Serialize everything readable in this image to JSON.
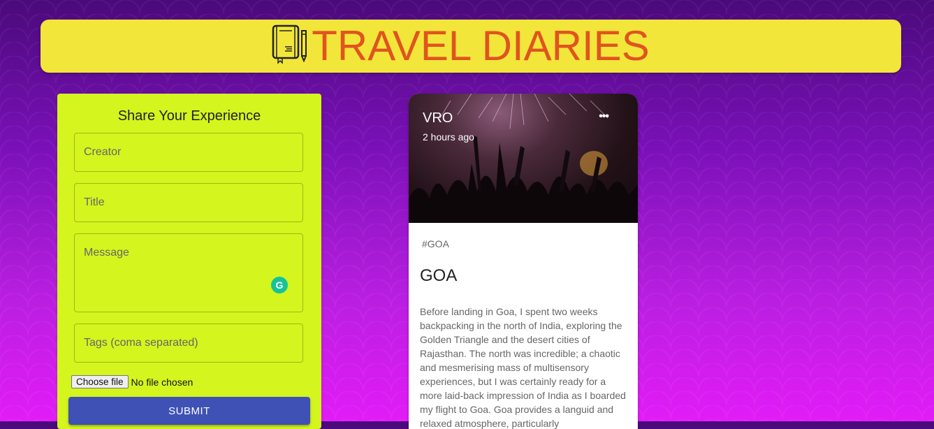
{
  "header": {
    "title": "TRAVEL DIARIES",
    "icon": "diary-book-icon"
  },
  "form": {
    "title": "Share Your Experience",
    "creator_placeholder": "Creator",
    "title_placeholder": "Title",
    "message_placeholder": "Message",
    "tags_placeholder": "Tags (coma separated)",
    "file_button_label": "Choose file",
    "file_status": "No file chosen",
    "submit_label": "SUBMIT",
    "grammarly_glyph": "G"
  },
  "post": {
    "creator": "VRO",
    "time": "2 hours ago",
    "more_glyph": "•••",
    "tags": "#GOA",
    "title": "GOA",
    "message": "Before landing in Goa, I spent two weeks backpacking in the north of India, exploring the Golden Triangle and the desert cities of Rajasthan. The north was incredible; a chaotic and mesmerising mass of multisensory experiences, but I was certainly ready for a more laid-back impression of India as I boarded my flight to Goa. Goa provides a languid and relaxed atmosphere, particularly"
  },
  "colors": {
    "header_bg": "#f2e63a",
    "header_title": "#e0541f",
    "form_bg": "#d4f51e",
    "submit_bg": "#3f51b5",
    "grammarly": "#15c39a"
  }
}
